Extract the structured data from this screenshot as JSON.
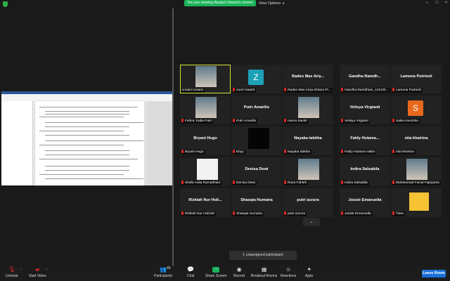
{
  "banner": {
    "viewing_text": "You are viewing Amalul Umami's screen",
    "view_options": "View Options"
  },
  "colors": {
    "banner_green": "#1bb35a",
    "active_speaker": "#d8e63a",
    "leave_blue": "#1a6fd8",
    "mic_red": "#e02828"
  },
  "tiles": [
    {
      "name": "",
      "label": "Amalul Umami",
      "muted": false,
      "kind": "photo"
    },
    {
      "name": "",
      "label": "zoom baa04",
      "muted": true,
      "kind": "avatar",
      "letter": "Z",
      "avatar_color": "#1ca0b7"
    },
    {
      "name": "Raden Mas Ariy...",
      "label": "Raden Mas Ariya Dhana Pr...",
      "muted": true,
      "kind": "name"
    },
    {
      "name": "Gandha Ramdh...",
      "label": "Gandha Ramdhani_121100...",
      "muted": true,
      "kind": "name"
    },
    {
      "name": "Lamona Putriesli",
      "label": "Lamona Putriesli",
      "muted": true,
      "kind": "name"
    },
    {
      "name": "",
      "label": "Fahira Yudia Putri",
      "muted": true,
      "kind": "photo"
    },
    {
      "name": "Putri Amarilis",
      "label": "Putri Amarilis",
      "muted": true,
      "kind": "name"
    },
    {
      "name": "",
      "label": "Haura Savitri",
      "muted": true,
      "kind": "photo"
    },
    {
      "name": "Velisya Virgianti",
      "label": "Velisya Virgianti",
      "muted": true,
      "kind": "name"
    },
    {
      "name": "",
      "label": "Salsa Kevrizka",
      "muted": true,
      "kind": "avatar",
      "letter": "S",
      "avatar_color": "#e8681c"
    },
    {
      "name": "Bryant Hugo",
      "label": "Bryant Hugo",
      "muted": true,
      "kind": "name"
    },
    {
      "name": "",
      "label": "Ebyy",
      "muted": true,
      "kind": "dark"
    },
    {
      "name": "Nayaka tabitha",
      "label": "Nayaka tabitha",
      "muted": true,
      "kind": "name"
    },
    {
      "name": "Faldy Hutama...",
      "label": "Faldy Hutama Halim",
      "muted": true,
      "kind": "name"
    },
    {
      "name": "nita khairina",
      "label": "nita khairina",
      "muted": true,
      "kind": "name"
    },
    {
      "name": "",
      "label": "Shafa Aulia Ramadhani",
      "muted": true,
      "kind": "white"
    },
    {
      "name": "Denisa Dewi",
      "label": "Denisa Dewi",
      "muted": true,
      "kind": "name"
    },
    {
      "name": "",
      "label": "Raza Fahlefi",
      "muted": true,
      "kind": "photo"
    },
    {
      "name": "Indira Salsabila",
      "label": "Indira Salsabila",
      "muted": true,
      "kind": "name"
    },
    {
      "name": "",
      "label": "Muhammad Faizal Fajriyanto",
      "muted": true,
      "kind": "photo"
    },
    {
      "name": "Rizkiah Nur Holi...",
      "label": "Rizkiah Nur Holizah",
      "muted": true,
      "kind": "name"
    },
    {
      "name": "Shasqia Humaira",
      "label": "Shasqia Humaira",
      "muted": true,
      "kind": "name"
    },
    {
      "name": "putri azzura",
      "label": "putri azzura",
      "muted": true,
      "kind": "name"
    },
    {
      "name": "Jossie Emanuella",
      "label": "Jossie Emanuella",
      "muted": true,
      "kind": "name"
    },
    {
      "name": "",
      "label": "Tiara",
      "muted": true,
      "kind": "yellow"
    }
  ],
  "more_icon": "chevron-down-icon",
  "unassigned": "1 unassigned participant",
  "toolbar": {
    "unmute": "Unmute",
    "start_video": "Start Video",
    "participants": "Participants",
    "participants_count": "46",
    "chat": "Chat",
    "share_screen": "Share Screen",
    "record": "Record",
    "breakout": "Breakout Rooms",
    "reactions": "Reactions",
    "apps": "Apps",
    "leave": "Leave Room"
  }
}
